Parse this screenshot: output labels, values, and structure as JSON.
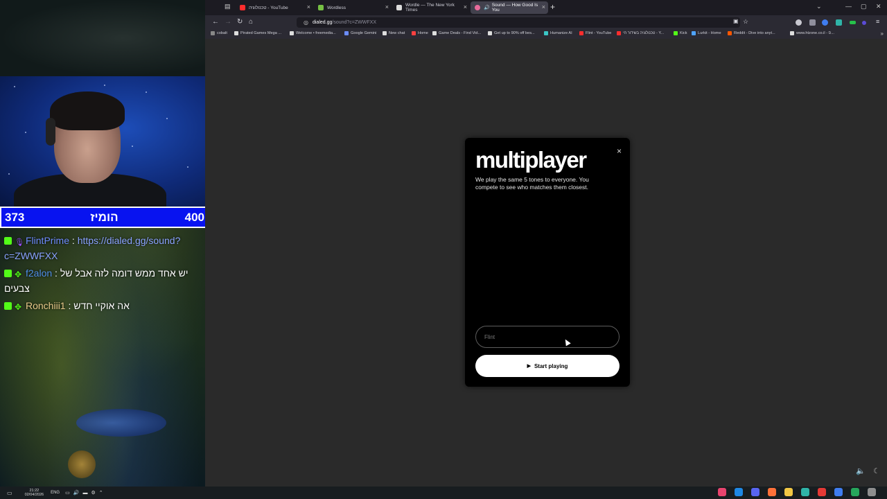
{
  "stream": {
    "score_left": "373",
    "score_title": "הומיז",
    "score_right": "400",
    "chat": [
      {
        "user": "FlintPrime",
        "user_color": "#6e8cff",
        "message": "https://dialed.gg/sound?c=ZWWFXX",
        "is_link": true
      },
      {
        "user": "f2alon",
        "user_color": "#4f8ee8",
        "message": "יש אחד ממש דומה לזה אבל של צבעים",
        "is_link": false
      },
      {
        "user": "Ronchiii1",
        "user_color": "#e8c98a",
        "message": "אה אוקיי חדש",
        "is_link": false
      }
    ],
    "chat_separator": " : "
  },
  "browser": {
    "tabs": [
      {
        "label": "טכנולוגיה - YouTube",
        "favicon_color": "#ff2d2d",
        "active": false
      },
      {
        "label": "Wordless",
        "favicon_color": "#76c043",
        "active": false
      },
      {
        "label": "Wordle — The New York Times",
        "favicon_color": "#dcdcdc",
        "active": false
      },
      {
        "label": "Sound — How Good Is You",
        "favicon_color": "#e86b9b",
        "active": true
      }
    ],
    "url_host": "dialed.gg",
    "url_path": "/sound?c=ZWWFXX",
    "bookmarks": [
      {
        "label": "cobalt",
        "color": "#888888"
      },
      {
        "label": "Pirated Games Mega ...",
        "color": "#dddddd"
      },
      {
        "label": "Welcome • freemedia...",
        "color": "#dddddd"
      },
      {
        "label": "Google Gemini",
        "color": "#6b8cff"
      },
      {
        "label": "New chat",
        "color": "#dddddd"
      },
      {
        "label": "Home",
        "color": "#ff4040"
      },
      {
        "label": "Game Deals - Find Vid...",
        "color": "#dddddd"
      },
      {
        "label": "Get up to 90% off bes...",
        "color": "#dddddd"
      },
      {
        "label": "Humanize AI",
        "color": "#3bc6c6"
      },
      {
        "label": "Flint - YouTube",
        "color": "#ff2d2d"
      },
      {
        "label": "טכנולוגיה בשידור חי - Y...",
        "color": "#ff2d2d"
      },
      {
        "label": "Kick",
        "color": "#53fc18"
      },
      {
        "label": "Lurkit - Home",
        "color": "#4fa3ff"
      },
      {
        "label": "Reddit - Dive into anyt...",
        "color": "#ff5700"
      },
      {
        "label": "www.htzone.co.il - ס...",
        "color": "#dddddd"
      }
    ]
  },
  "modal": {
    "title": "multiplayer",
    "description": "We play the same 5 tones to everyone. You compete to see who matches them closest.",
    "name_placeholder": "Flint",
    "start_label": "Start playing",
    "close_icon": "×"
  },
  "taskbar": {
    "time": "21:22",
    "date": "02/04/2026",
    "lang": "ENG",
    "apps": [
      "#e8446e",
      "#1e88e5",
      "#5865f2",
      "#ff7139",
      "#f2c744",
      "#2fb4a8",
      "#e53935",
      "#3f7df0",
      "#26a65b",
      "#8e8e8e"
    ]
  }
}
